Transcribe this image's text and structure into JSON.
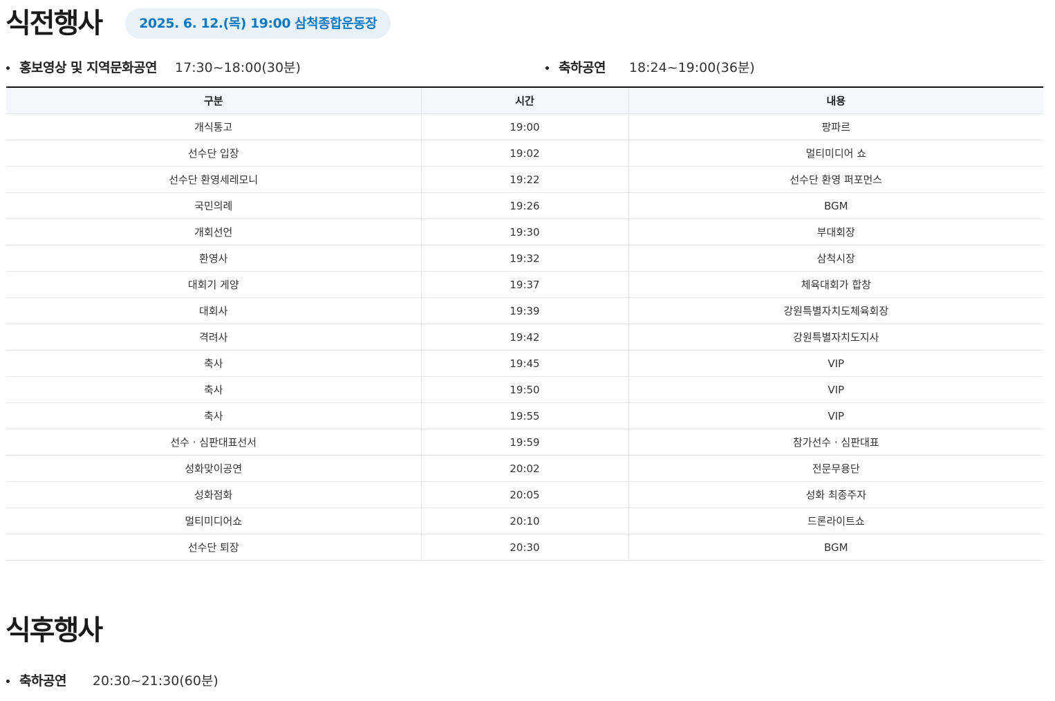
{
  "pre_ceremony": {
    "title": "식전행사",
    "date_badge": "2025. 6. 12.(목) 19:00 삼척종합운동장",
    "events": [
      {
        "label": "홍보영상 및 지역문화공연",
        "time": "17:30~18:00(30분)"
      },
      {
        "label": "축하공연",
        "time": "18:24~19:00(36분)"
      }
    ]
  },
  "schedule_table": {
    "columns": [
      "구분",
      "시간",
      "내용"
    ],
    "rows": [
      {
        "category": "개식통고",
        "time": "19:00",
        "content": "팡파르"
      },
      {
        "category": "선수단 입장",
        "time": "19:02",
        "content": "멀티미디어 쇼"
      },
      {
        "category": "선수단 환영세레모니",
        "time": "19:22",
        "content": "선수단 환영 퍼포먼스"
      },
      {
        "category": "국민의례",
        "time": "19:26",
        "content": "BGM"
      },
      {
        "category": "개회선언",
        "time": "19:30",
        "content": "부대회장"
      },
      {
        "category": "환영사",
        "time": "19:32",
        "content": "삼척시장"
      },
      {
        "category": "대회기 게양",
        "time": "19:37",
        "content": "체육대회가 합창"
      },
      {
        "category": "대회사",
        "time": "19:39",
        "content": "강원특별자치도체육회장"
      },
      {
        "category": "격려사",
        "time": "19:42",
        "content": "강원특별자치도지사"
      },
      {
        "category": "축사",
        "time": "19:45",
        "content": "VIP"
      },
      {
        "category": "축사",
        "time": "19:50",
        "content": "VIP"
      },
      {
        "category": "축사",
        "time": "19:55",
        "content": "VIP"
      },
      {
        "category": "선수 · 심판대표선서",
        "time": "19:59",
        "content": "참가선수 · 심판대표"
      },
      {
        "category": "성화맞이공연",
        "time": "20:02",
        "content": "전문무용단"
      },
      {
        "category": "성화점화",
        "time": "20:05",
        "content": "성화 최종주자"
      },
      {
        "category": "멀티미디어쇼",
        "time": "20:10",
        "content": "드론라이트쇼"
      },
      {
        "category": "선수단 퇴장",
        "time": "20:30",
        "content": "BGM"
      }
    ]
  },
  "post_ceremony": {
    "title": "식후행사",
    "events": [
      {
        "label": "축하공연",
        "time": "20:30~21:30(60분)"
      }
    ]
  },
  "colors": {
    "badge_text": "#0b78c2",
    "badge_bg": "#e8f1f8",
    "table_header_bg": "#f3f7fd"
  }
}
